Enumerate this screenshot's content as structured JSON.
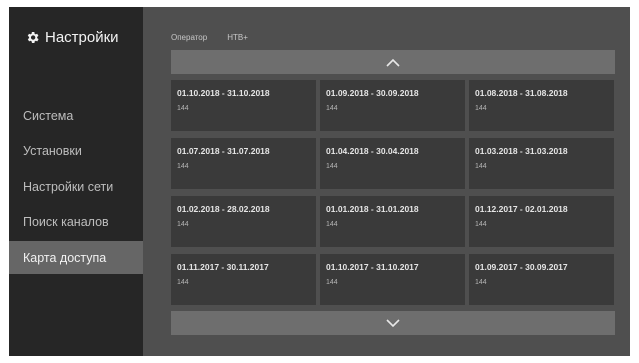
{
  "sidebar": {
    "title": "Настройки",
    "title_icon": "gear-icon",
    "items": [
      {
        "label": "Система",
        "active": false
      },
      {
        "label": "Установки",
        "active": false
      },
      {
        "label": "Настройки сети",
        "active": false
      },
      {
        "label": "Поиск каналов",
        "active": false
      },
      {
        "label": "Карта доступа",
        "active": true
      }
    ]
  },
  "header": {
    "operator_label": "Оператор",
    "operator_value": "НТВ+"
  },
  "scroll": {
    "up_icon": "chevron-up-icon",
    "down_icon": "chevron-down-icon"
  },
  "periods": [
    {
      "period": "01.10.2018 - 31.10.2018",
      "count": "144"
    },
    {
      "period": "01.09.2018 - 30.09.2018",
      "count": "144"
    },
    {
      "period": "01.08.2018 - 31.08.2018",
      "count": "144"
    },
    {
      "period": "01.07.2018 - 31.07.2018",
      "count": "144"
    },
    {
      "period": "01.04.2018 - 30.04.2018",
      "count": "144"
    },
    {
      "period": "01.03.2018 - 31.03.2018",
      "count": "144"
    },
    {
      "period": "01.02.2018 - 28.02.2018",
      "count": "144"
    },
    {
      "period": "01.01.2018 - 31.01.2018",
      "count": "144"
    },
    {
      "period": "01.12.2017 - 02.01.2018",
      "count": "144"
    },
    {
      "period": "01.11.2017 - 30.11.2017",
      "count": "144"
    },
    {
      "period": "01.10.2017 - 31.10.2017",
      "count": "144"
    },
    {
      "period": "01.09.2017 - 30.09.2017",
      "count": "144"
    }
  ],
  "colors": {
    "background": "#4f4f4f",
    "sidebar": "#262626",
    "active_item": "#666666",
    "cell": "#3a3a3a",
    "scroll_bar": "#6e6e6e"
  }
}
